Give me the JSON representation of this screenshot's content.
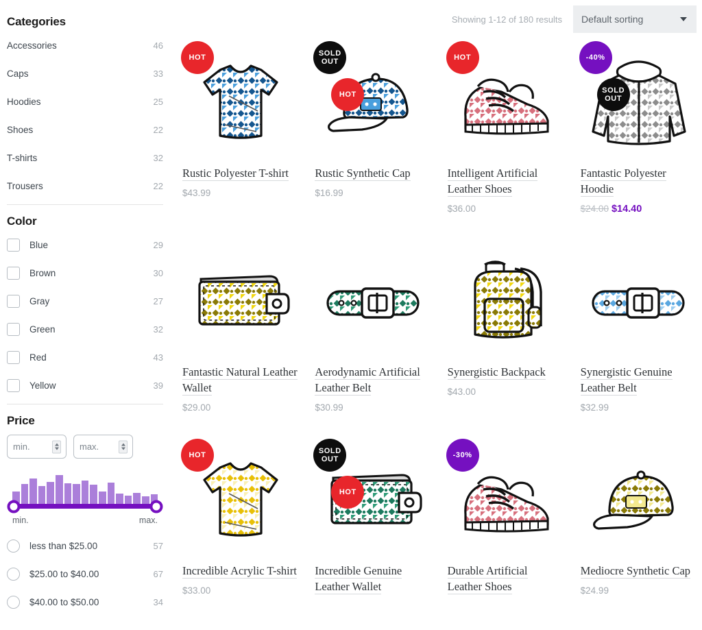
{
  "sidebar": {
    "categories": {
      "title": "Categories",
      "items": [
        {
          "label": "Accessories",
          "count": "46"
        },
        {
          "label": "Caps",
          "count": "33"
        },
        {
          "label": "Hoodies",
          "count": "25"
        },
        {
          "label": "Shoes",
          "count": "22"
        },
        {
          "label": "T-shirts",
          "count": "32"
        },
        {
          "label": "Trousers",
          "count": "22"
        }
      ]
    },
    "color": {
      "title": "Color",
      "items": [
        {
          "label": "Blue",
          "count": "29"
        },
        {
          "label": "Brown",
          "count": "30"
        },
        {
          "label": "Gray",
          "count": "27"
        },
        {
          "label": "Green",
          "count": "32"
        },
        {
          "label": "Red",
          "count": "43"
        },
        {
          "label": "Yellow",
          "count": "39"
        }
      ]
    },
    "price": {
      "title": "Price",
      "min_placeholder": "min.",
      "max_placeholder": "max.",
      "slider_min_label": "min.",
      "slider_max_label": "max.",
      "histogram": [
        40,
        62,
        80,
        56,
        70,
        92,
        66,
        64,
        74,
        60,
        40,
        68,
        32,
        26,
        34,
        24,
        30
      ],
      "ranges": [
        {
          "label": "less than $25.00",
          "count": "57"
        },
        {
          "label": "$25.00 to $40.00",
          "count": "67"
        },
        {
          "label": "$40.00 to $50.00",
          "count": "34"
        }
      ]
    }
  },
  "toolbar": {
    "results_text": "Showing 1-12 of 180 results",
    "sort_selected": "Default sorting"
  },
  "colors": {
    "hot_badge": "#e8262b",
    "sold_badge": "#0d0d0d",
    "discount_badge": "#7510c0",
    "sale_price": "#7510c0",
    "slider": "#7510c0",
    "histogram_bar": "#ab7fda"
  },
  "products": [
    {
      "title": "Rustic Polyester T-shirt",
      "price": "$43.99",
      "old_price": "",
      "sale_price": "",
      "badges": [
        "HOT"
      ],
      "art": "tshirt-blue"
    },
    {
      "title": "Rustic Synthetic Cap",
      "price": "$16.99",
      "old_price": "",
      "sale_price": "",
      "badges": [
        "SOLD OUT",
        "HOT"
      ],
      "art": "cap-blue"
    },
    {
      "title": "Intelligent Artificial Leather Shoes",
      "price": "$36.00",
      "old_price": "",
      "sale_price": "",
      "badges": [
        "HOT"
      ],
      "art": "shoes-pink"
    },
    {
      "title": "Fantastic Polyester Hoodie",
      "price": "",
      "old_price": "$24.00",
      "sale_price": "$14.40",
      "badges": [
        "-40%",
        "SOLD OUT"
      ],
      "art": "hoodie-gray"
    },
    {
      "title": "Fantastic Natural Leather Wallet",
      "price": "$29.00",
      "old_price": "",
      "sale_price": "",
      "badges": [],
      "art": "wallet-olive"
    },
    {
      "title": "Aerodynamic Artificial Leather Belt",
      "price": "$30.99",
      "old_price": "",
      "sale_price": "",
      "badges": [],
      "art": "belt-green"
    },
    {
      "title": "Synergistic Backpack",
      "price": "$43.00",
      "old_price": "",
      "sale_price": "",
      "badges": [],
      "art": "backpack-yellow"
    },
    {
      "title": "Synergistic Genuine Leather Belt",
      "price": "$32.99",
      "old_price": "",
      "sale_price": "",
      "badges": [],
      "art": "belt-blue"
    },
    {
      "title": "Incredible Acrylic T-shirt",
      "price": "$33.00",
      "old_price": "",
      "sale_price": "",
      "badges": [
        "HOT"
      ],
      "art": "tshirt-yellow"
    },
    {
      "title": "Incredible Genuine Leather Wallet",
      "price": "",
      "old_price": "",
      "sale_price": "",
      "badges": [
        "SOLD OUT",
        "HOT"
      ],
      "art": "wallet-green"
    },
    {
      "title": "Durable Artificial Leather Shoes",
      "price": "",
      "old_price": "",
      "sale_price": "",
      "badges": [
        "-30%"
      ],
      "art": "shoes-pink2"
    },
    {
      "title": "Mediocre Synthetic Cap",
      "price": "$24.99",
      "old_price": "",
      "sale_price": "",
      "badges": [],
      "art": "cap-olive"
    }
  ]
}
